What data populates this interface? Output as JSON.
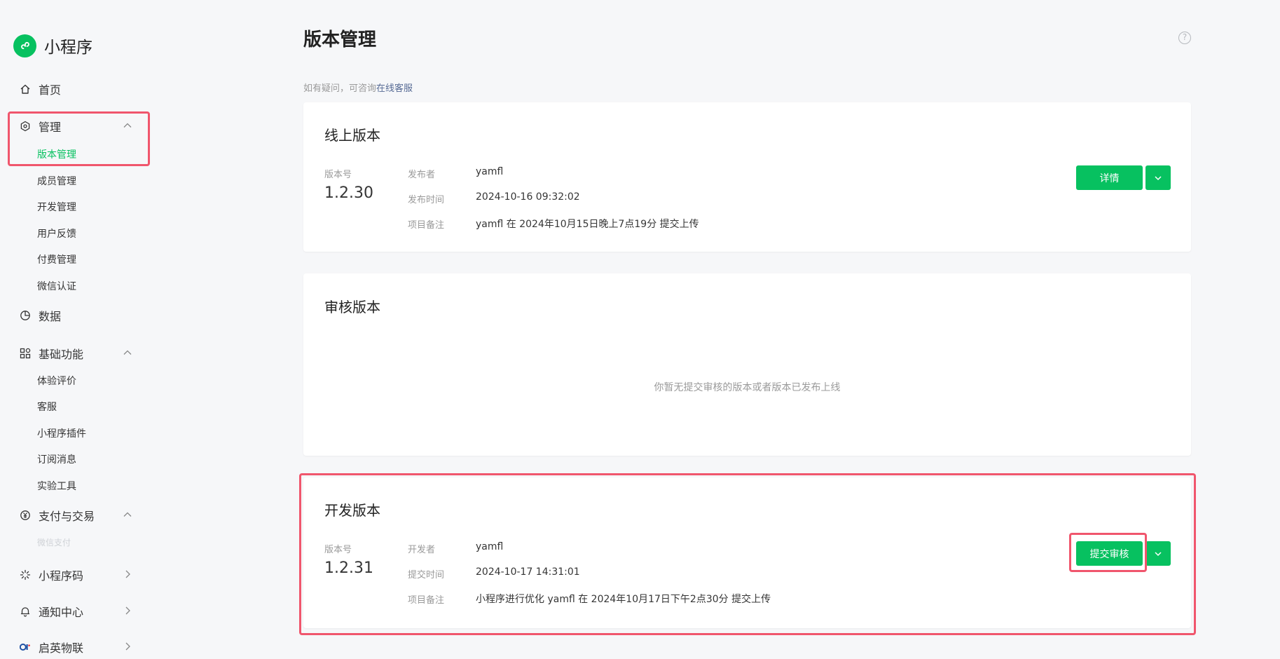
{
  "sidebar": {
    "brand": "小程序",
    "home": "首页",
    "manage": "管理",
    "manage_items": [
      "版本管理",
      "成员管理",
      "开发管理",
      "用户反馈",
      "付费管理",
      "微信认证"
    ],
    "data": "数据",
    "basic": "基础功能",
    "basic_items": [
      "体验评价",
      "客服",
      "小程序插件",
      "订阅消息",
      "实验工具"
    ],
    "pay": "支付与交易",
    "pay_sub_faded": "微信支付",
    "qrcode": "小程序码",
    "notify": "通知中心",
    "qiying": "启英物联"
  },
  "page": {
    "title": "版本管理",
    "hint_prefix": "如有疑问，可咨询",
    "hint_link": "在线客服"
  },
  "online": {
    "title": "线上版本",
    "version_label": "版本号",
    "version": "1.2.30",
    "publisher_key": "发布者",
    "publisher": "yamfl",
    "time_key": "发布时间",
    "time": "2024-10-16 09:32:02",
    "note_key": "项目备注",
    "note": "yamfl 在 2024年10月15日晚上7点19分 提交上传",
    "detail_btn": "详情"
  },
  "review": {
    "title": "审核版本",
    "empty": "你暂无提交审核的版本或者版本已发布上线"
  },
  "dev": {
    "title": "开发版本",
    "version_label": "版本号",
    "version": "1.2.31",
    "developer_key": "开发者",
    "developer": "yamfl",
    "time_key": "提交时间",
    "time": "2024-10-17 14:31:01",
    "note_key": "项目备注",
    "note": "小程序进行优化 yamfl 在 2024年10月17日下午2点30分 提交上传",
    "submit_btn": "提交审核"
  },
  "colors": {
    "brand_green": "#07c160",
    "highlight_red": "#f0566d",
    "link_blue": "#576b95"
  }
}
